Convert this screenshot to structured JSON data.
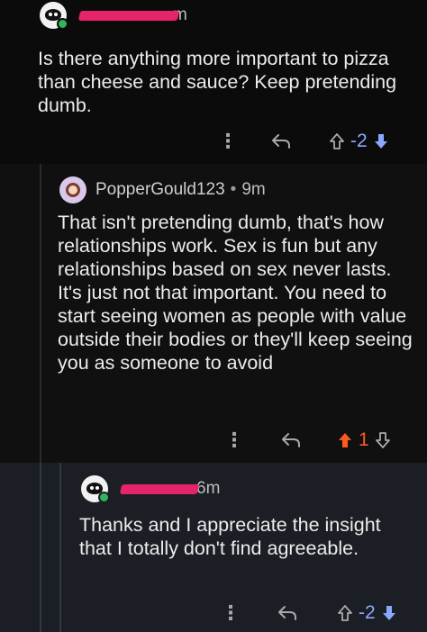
{
  "comments": [
    {
      "time_suffix": "m",
      "text": "Is there anything more important to pizza than cheese and sauce? Keep pretending dumb.",
      "score": "-2"
    },
    {
      "username": "PopperGould123",
      "separator": "•",
      "time": "9m",
      "text": "That isn't pretending dumb, that's how relationships work. Sex is fun but any relationships based on sex never lasts. It's just not that important. You need to start seeing women as people with value outside their bodies or they'll keep seeing you as someone to avoid",
      "score": "1"
    },
    {
      "time_suffix": "6m",
      "text": "Thanks and I appreciate the insight that I totally don't find agreeable.",
      "score": "-2"
    }
  ],
  "icons": {
    "more": "more-icon",
    "reply": "reply-icon",
    "upvote": "upvote-icon",
    "downvote": "downvote-icon"
  },
  "colors": {
    "upvote_active": "#ff5b1f",
    "downvote_active": "#8aa8ff",
    "redaction": "#e6246a",
    "online": "#2fb55d"
  }
}
